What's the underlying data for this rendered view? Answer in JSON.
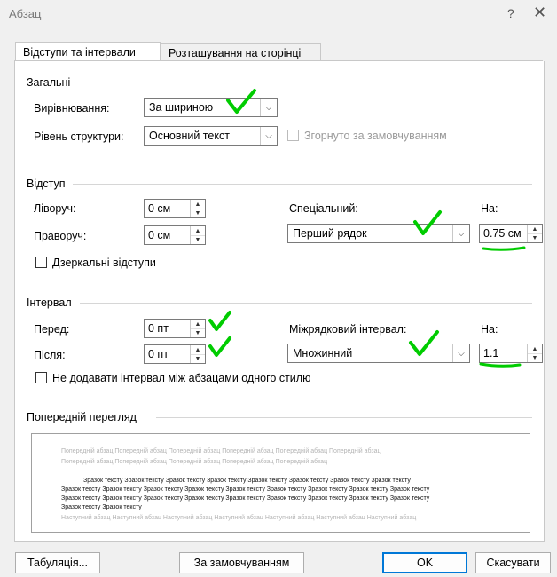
{
  "window": {
    "title": "Абзац",
    "help": "?",
    "close": "✕"
  },
  "tabs": [
    {
      "label": "Відступи та інтервали",
      "active": true
    },
    {
      "label": "Розташування на сторінці",
      "active": false
    }
  ],
  "general": {
    "title": "Загальні",
    "alignment_label": "Вирівнювання:",
    "alignment_value": "За шириною",
    "outline_label": "Рівень структури:",
    "outline_value": "Основний текст",
    "collapsed_label": "Згорнуто за замовчуванням"
  },
  "indent": {
    "title": "Відступ",
    "left_label": "Ліворуч:",
    "left_value": "0 см",
    "right_label": "Праворуч:",
    "right_value": "0 см",
    "special_label": "Спеціальний:",
    "special_value": "Перший рядок",
    "by_label": "На:",
    "by_value": "0.75 см",
    "mirror_label": "Дзеркальні відступи"
  },
  "spacing": {
    "title": "Інтервал",
    "before_label": "Перед:",
    "before_value": "0 пт",
    "after_label": "Після:",
    "after_value": "0 пт",
    "line_label": "Міжрядковий інтервал:",
    "line_value": "Множинний",
    "at_label": "На:",
    "at_value": "1.1",
    "dont_add_label": "Не додавати інтервал між абзацами одного стилю"
  },
  "preview": {
    "title": "Попередній перегляд",
    "prev_1": "Попередній абзац Попередній абзац Попередній абзац Попередній абзац Попередній абзац Попередній абзац",
    "prev_2": "Попередній абзац Попередній абзац Попередній абзац Попередній абзац Попередній абзац",
    "sample_1": "Зразок тексту Зразок тексту Зразок тексту Зразок тексту Зразок тексту Зразок тексту Зразок тексту Зразок тексту",
    "sample_2": "Зразок тексту Зразок тексту Зразок тексту Зразок тексту Зразок тексту Зразок тексту Зразок тексту Зразок тексту Зразок тексту",
    "sample_3": "Зразок тексту Зразок тексту Зразок тексту Зразок тексту Зразок тексту Зразок тексту Зразок тексту Зразок тексту Зразок тексту",
    "sample_4": "Зразок тексту Зразок тексту",
    "next_1": "Наступний абзац Наступний абзац Наступний абзац Наступний абзац Наступний абзац Наступний абзац Наступний абзац"
  },
  "buttons": {
    "tabs": "Табуляція...",
    "default": "За замовчуванням",
    "ok": "OK",
    "cancel": "Скасувати"
  },
  "colors": {
    "annotation": "#00cc00",
    "ok_border": "#0078d7"
  }
}
